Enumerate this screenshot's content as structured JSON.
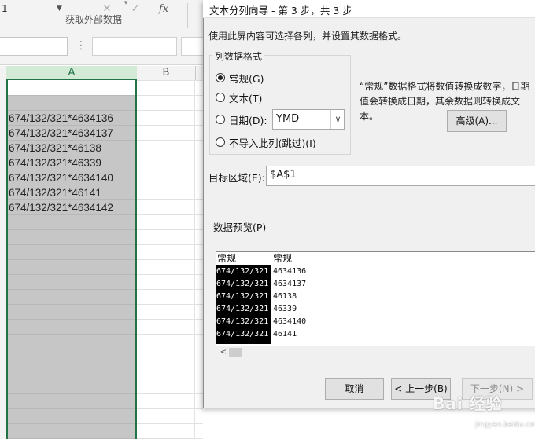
{
  "excel": {
    "ribbon_group": "获取外部数据",
    "namebox": "1",
    "formula_icons": {
      "cancel": "✕",
      "enter": "✓",
      "fx": "fx"
    },
    "columns": [
      "A",
      "B"
    ],
    "cells": [
      "674/132/321*4634136",
      "674/132/321*4634137",
      "674/132/321*46138",
      "674/132/321*46339",
      "674/132/321*4634140",
      "674/132/321*46141",
      "674/132/321*4634142"
    ]
  },
  "dialog": {
    "title": "文本分列向导 - 第 3 步，共 3 步",
    "intro": "使用此屏内容可选择各列，并设置其数据格式。",
    "group_label": "列数据格式",
    "radios": {
      "general": "常规(G)",
      "text": "文本(T)",
      "date": "日期(D):",
      "skip": "不导入此列(跳过)(I)"
    },
    "selected": "general",
    "date_format": "YMD",
    "description": "“常规”数据格式将数值转换成数字，日期值会转换成日期，其余数据则转换成文本。",
    "advanced_button": "高级(A)...",
    "destination_label": "目标区域(E):",
    "destination_value": "$A$1",
    "preview_label": "数据预览(P)",
    "preview": {
      "headers": [
        "常规",
        "常规"
      ],
      "rows": [
        [
          "674/132/321",
          "4634136"
        ],
        [
          "674/132/321",
          "4634137"
        ],
        [
          "674/132/321",
          "46138"
        ],
        [
          "674/132/321",
          "46339"
        ],
        [
          "674/132/321",
          "4634140"
        ],
        [
          "674/132/321",
          "46141"
        ]
      ]
    },
    "buttons": {
      "cancel": "取消",
      "back": "< 上一步(B)",
      "next": "下一步(N) >"
    }
  },
  "watermark": {
    "text": "Bai 经验",
    "sub": "jingyan.baidu.com"
  },
  "colors": {
    "excel_green": "#217346",
    "selection_gray": "#c6c6c6",
    "dialog_bg": "#f0f0f0"
  }
}
